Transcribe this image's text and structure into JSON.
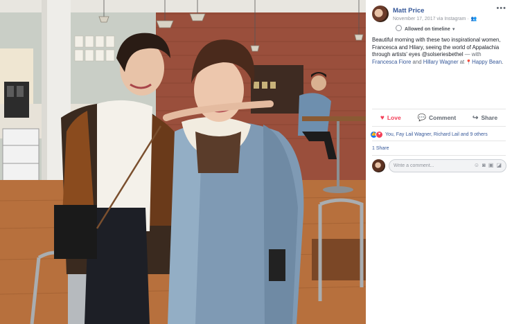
{
  "post": {
    "author": "Matt Price",
    "meta": "November 17, 2017 via Instagram ·",
    "allowed_on_timeline": "Allowed on timeline",
    "caption_text": "Beautiful morning with these two inspirational women, Francesca and Hilary, seeing the world of Appalachia through artists' eyes @solseriesbethel",
    "with_prefix": "— with",
    "tagged_1": "Francesca Fiore",
    "and_word": "and",
    "tagged_2": "Hillary Wagner",
    "at_word": "at",
    "location": "Happy Bean",
    "location_suffix": "."
  },
  "actions": {
    "love": "Love",
    "comment": "Comment",
    "share": "Share"
  },
  "reactions": {
    "summary": "You, Fay Lail Wagner, Richard Lail and 9 others"
  },
  "shares": "1 Share",
  "comment_box": {
    "placeholder": "Write a comment..."
  },
  "colors": {
    "link": "#365899",
    "love": "#f33e58",
    "like": "#1877f2",
    "divider": "#e5e5e5"
  },
  "icons": {
    "more": "more-horizontal-icon",
    "audience": "people-icon",
    "location": "location-pin-icon",
    "love": "heart-icon",
    "comment": "speech-bubble-icon",
    "share": "share-arrow-icon",
    "emoji": "emoji-icon",
    "camera": "camera-icon",
    "gif": "gif-icon",
    "sticker": "sticker-icon"
  }
}
